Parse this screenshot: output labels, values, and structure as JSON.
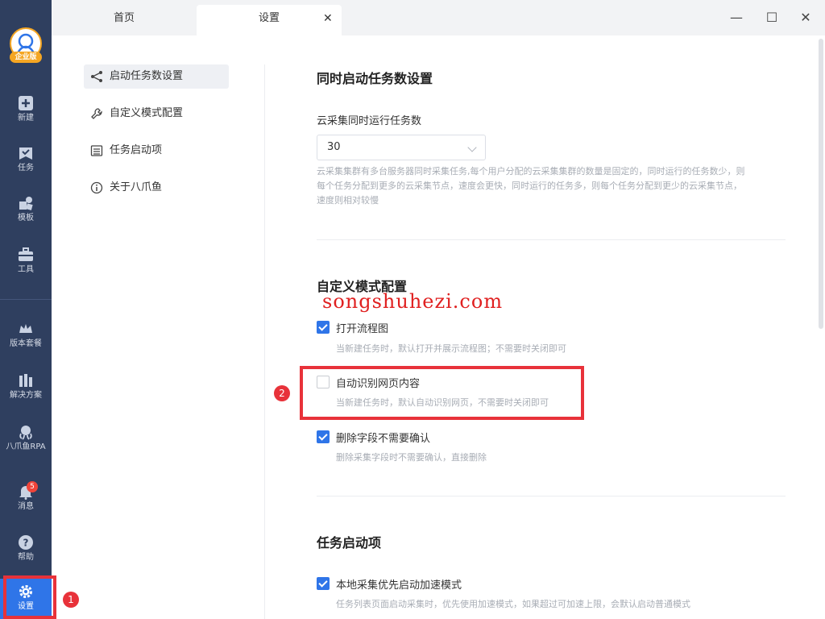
{
  "rail": {
    "logo_badge": "企业版",
    "items": [
      {
        "label": "新建",
        "icon": "plus-square-icon"
      },
      {
        "label": "任务",
        "icon": "task-check-icon"
      },
      {
        "label": "模板",
        "icon": "template-icon"
      },
      {
        "label": "工具",
        "icon": "toolbox-icon"
      },
      {
        "label": "版本套餐",
        "icon": "crown-icon"
      },
      {
        "label": "解决方案",
        "icon": "solution-icon"
      },
      {
        "label": "八爪鱼RPA",
        "icon": "octopus-icon"
      },
      {
        "label": "消息",
        "icon": "bell-icon"
      },
      {
        "label": "帮助",
        "icon": "help-icon"
      },
      {
        "label": "设置",
        "icon": "gear-icon"
      }
    ],
    "message_count": "5"
  },
  "tabs": {
    "home": "首页",
    "settings": "设置"
  },
  "nav": {
    "items": [
      {
        "label": "启动任务数设置",
        "icon": "share-icon"
      },
      {
        "label": "自定义模式配置",
        "icon": "wrench-icon"
      },
      {
        "label": "任务启动项",
        "icon": "list-icon"
      },
      {
        "label": "关于八爪鱼",
        "icon": "info-icon"
      }
    ]
  },
  "section1": {
    "title": "同时启动任务数设置",
    "field_label": "云采集同时运行任务数",
    "select_value": "30",
    "desc_lines": [
      "云采集集群有多台服务器同时采集任务,每个用户分配的云采集集群的数量是固定的，同时运行的任务数少，则",
      "每个任务分配到更多的云采集节点，速度会更快，同时运行的任务多，则每个任务分配到更少的云采集节点，",
      "速度则相对较慢"
    ]
  },
  "section2": {
    "title": "自定义模式配置",
    "options": [
      {
        "label": "打开流程图",
        "desc": "当新建任务时，默认打开并展示流程图；不需要时关闭即可",
        "checked": true
      },
      {
        "label": "自动识别网页内容",
        "desc": "当新建任务时，默认自动识别网页，不需要时关闭即可",
        "checked": false
      },
      {
        "label": "删除字段不需要确认",
        "desc": "删除采集字段时不需要确认，直接删除",
        "checked": true
      }
    ]
  },
  "section3": {
    "title": "任务启动项",
    "options": [
      {
        "label": "本地采集优先启动加速模式",
        "desc": "任务列表页面启动采集时，优先使用加速模式，如果超过可加速上限，会默认启动普通模式",
        "checked": true
      }
    ]
  },
  "watermark": "songshuhezi.com",
  "annotations": {
    "marker1": "1",
    "marker2": "2"
  },
  "colors": {
    "rail": "#2f3f5f",
    "accent": "#2f75e8",
    "annotation": "#e8323a"
  }
}
